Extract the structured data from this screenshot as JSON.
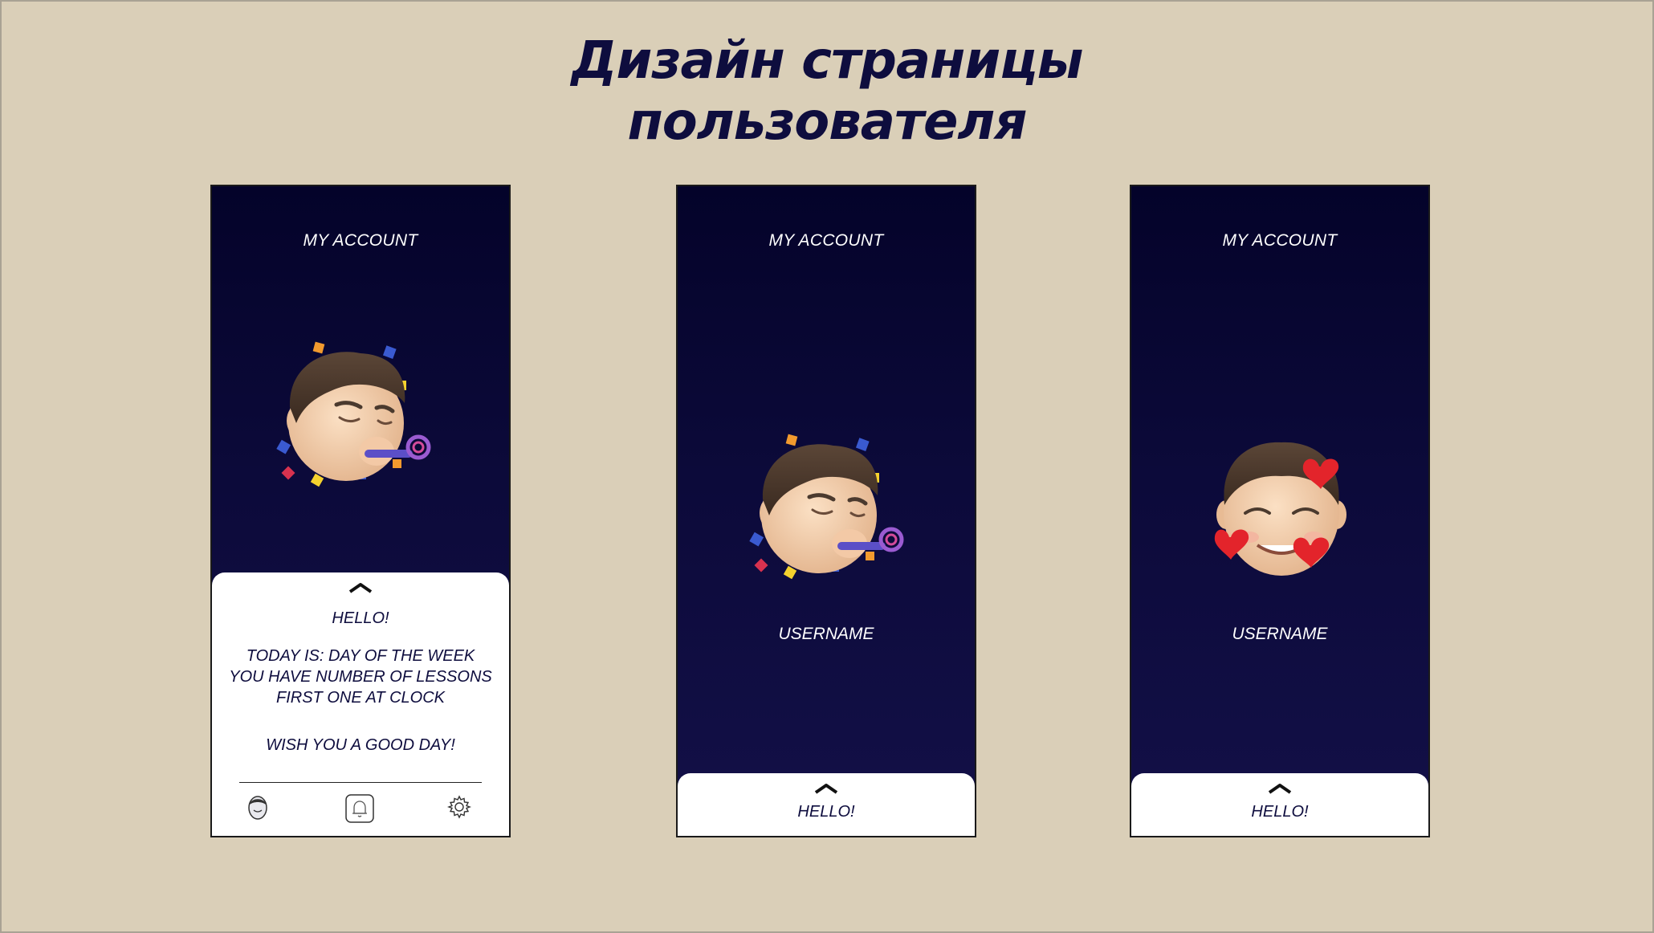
{
  "page": {
    "title_line1": "Дизайн страницы",
    "title_line2": "пользователя"
  },
  "screens": [
    {
      "header": "MY ACCOUNT",
      "avatar": "party-blower-memoji",
      "panel": {
        "state": "expanded",
        "greeting": "HELLO!",
        "lines": [
          "TODAY IS: DAY OF THE WEEK",
          "YOU HAVE NUMBER OF LESSONS",
          "FIRST ONE AT CLOCK"
        ],
        "wish": "WISH YOU A GOOD DAY!"
      },
      "nav": [
        "profile-icon",
        "bell-icon",
        "gear-icon"
      ]
    },
    {
      "header": "MY ACCOUNT",
      "avatar": "party-blower-memoji",
      "username": "USERNAME",
      "panel": {
        "state": "collapsed",
        "greeting": "HELLO!"
      }
    },
    {
      "header": "MY ACCOUNT",
      "avatar": "hearts-memoji",
      "username": "USERNAME",
      "panel": {
        "state": "collapsed",
        "greeting": "HELLO!"
      }
    }
  ],
  "colors": {
    "background": "#dacfb8",
    "title": "#0e0d3e",
    "screen_top": "#04032a",
    "screen_bottom": "#131048",
    "panel": "#ffffff"
  }
}
